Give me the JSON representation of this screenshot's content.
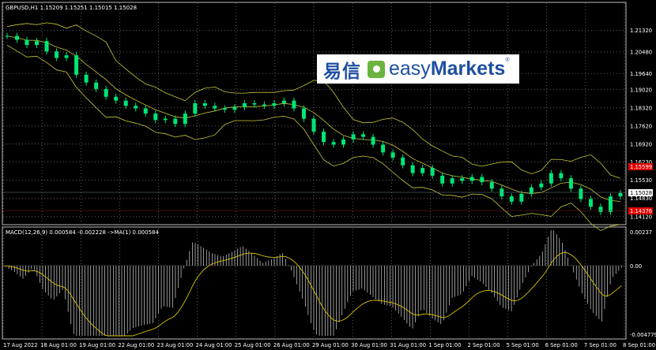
{
  "main_chart": {
    "symbol_header": "GBPUSD,H1  1.15209 1.15251 1.15015 1.15028",
    "price_ticks": [
      "1.21320",
      "1.20480",
      "1.19640",
      "1.19020",
      "1.18320",
      "1.17620",
      "1.16920",
      "1.16230",
      "1.15530",
      "1.14830",
      "1.14120"
    ],
    "price_range": [
      1.139,
      1.22
    ],
    "current_price": "1.15028",
    "red_level_upper": "1.15599",
    "red_level_lower": "1.14376"
  },
  "indicator": {
    "header": "MACD(12,26,9) 0.000584 -0.002228  ->MA(1) 0.000584",
    "ticks": [
      "0.00237",
      "0.00",
      "-0.004779"
    ]
  },
  "time_axis": [
    "17 Aug 2022",
    "18 Aug 01:00",
    "19 Aug 01:00",
    "22 Aug 01:00",
    "23 Aug 01:00",
    "24 Aug 01:00",
    "25 Aug 01:00",
    "26 Aug 01:00",
    "29 Aug 01:00",
    "30 Aug 01:00",
    "31 Aug 01:00",
    "1 Sep 01:00",
    "2 Sep 01:00",
    "5 Sep 01:00",
    "6 Sep 01:00",
    "7 Sep 01:00",
    "8 Sep 01:00"
  ],
  "logo": {
    "cn": "易信",
    "en_light": "easy",
    "en_bold": "Markets",
    "reg": "®"
  },
  "colors": {
    "background": "#000000",
    "grid": "#9a9a9a",
    "candle": "#00e676",
    "bands": "#c8c83a",
    "macd_hist": "#d8d8d8",
    "signal": "#d9c300",
    "price_label": "#ffffff",
    "red_label": "#e00000"
  },
  "chart_data": {
    "type": "line",
    "series": [],
    "x_labels": [
      "17 Aug 2022",
      "18 Aug 01:00",
      "19 Aug 01:00",
      "22 Aug 01:00",
      "23 Aug 01:00",
      "24 Aug 01:00",
      "25 Aug 01:00",
      "26 Aug 01:00",
      "29 Aug 01:00",
      "30 Aug 01:00",
      "31 Aug 01:00",
      "1 Sep 01:00",
      "2 Sep 01:00",
      "5 Sep 01:00",
      "6 Sep 01:00",
      "7 Sep 01:00",
      "8 Sep 01:00"
    ],
    "price_close_approx": [
      1.211,
      1.2095,
      1.2075,
      1.209,
      1.205,
      1.2025,
      1.2035,
      1.196,
      1.193,
      1.1905,
      1.1875,
      1.186,
      1.184,
      1.183,
      1.181,
      1.1785,
      1.179,
      1.177,
      1.181,
      1.185,
      1.184,
      1.183,
      1.1825,
      1.1835,
      1.185,
      1.1845,
      1.184,
      1.185,
      1.186,
      1.183,
      1.179,
      1.174,
      1.17,
      1.169,
      1.171,
      1.173,
      1.172,
      1.169,
      1.166,
      1.164,
      1.161,
      1.158,
      1.16,
      1.157,
      1.154,
      1.156,
      1.155,
      1.1565,
      1.1545,
      1.152,
      1.149,
      1.147,
      1.15,
      1.1525,
      1.154,
      1.158,
      1.156,
      1.152,
      1.148,
      1.145,
      1.143,
      1.149,
      1.1503
    ],
    "ylim": [
      1.139,
      1.22
    ],
    "grid": true
  }
}
